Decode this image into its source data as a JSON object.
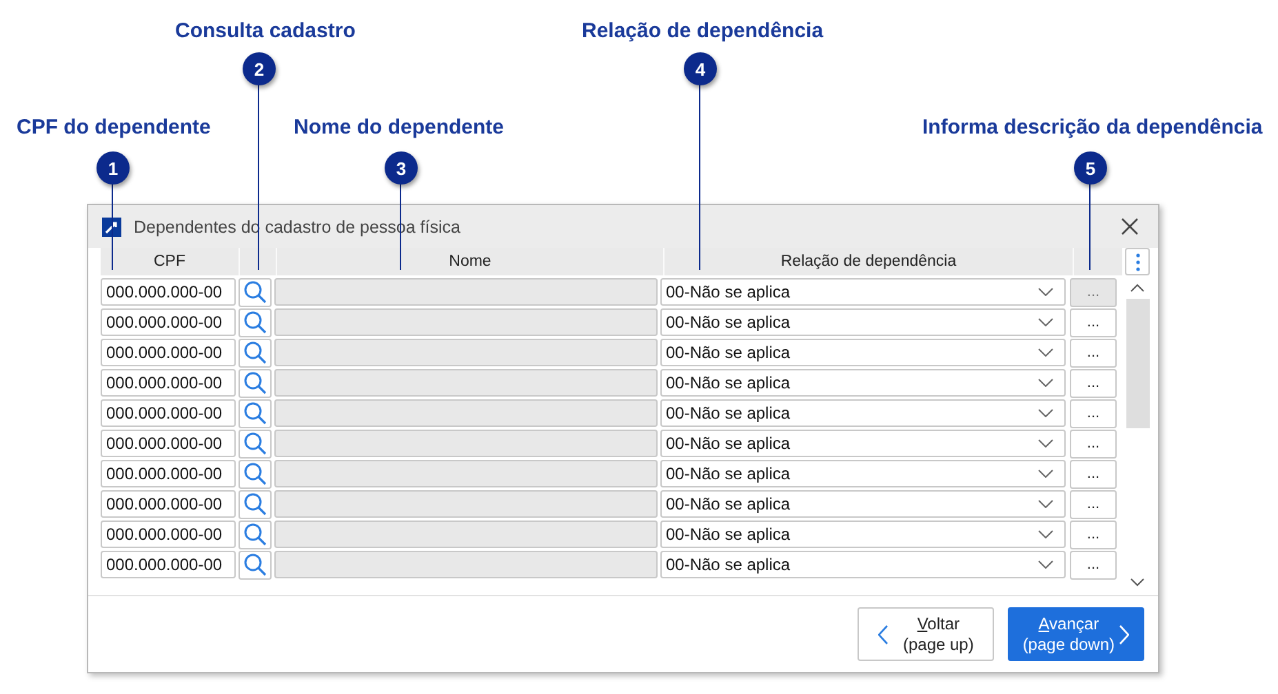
{
  "callouts": [
    {
      "number": "1",
      "label": "CPF do dependente"
    },
    {
      "number": "2",
      "label": "Consulta cadastro"
    },
    {
      "number": "3",
      "label": "Nome do dependente"
    },
    {
      "number": "4",
      "label": "Relação de dependência"
    },
    {
      "number": "5",
      "label": "Informa descrição da dependência"
    }
  ],
  "window": {
    "title": "Dependentes do cadastro de pessoa física"
  },
  "columns": [
    "CPF",
    "Nome",
    "Relação de dependência"
  ],
  "rows": [
    {
      "cpf": "000.000.000-00",
      "relation": "00-Não se aplica",
      "more": "...",
      "pressed": true
    },
    {
      "cpf": "000.000.000-00",
      "relation": "00-Não se aplica",
      "more": "...",
      "pressed": false
    },
    {
      "cpf": "000.000.000-00",
      "relation": "00-Não se aplica",
      "more": "...",
      "pressed": false
    },
    {
      "cpf": "000.000.000-00",
      "relation": "00-Não se aplica",
      "more": "...",
      "pressed": false
    },
    {
      "cpf": "000.000.000-00",
      "relation": "00-Não se aplica",
      "more": "...",
      "pressed": false
    },
    {
      "cpf": "000.000.000-00",
      "relation": "00-Não se aplica",
      "more": "...",
      "pressed": false
    },
    {
      "cpf": "000.000.000-00",
      "relation": "00-Não se aplica",
      "more": "...",
      "pressed": false
    },
    {
      "cpf": "000.000.000-00",
      "relation": "00-Não se aplica",
      "more": "...",
      "pressed": false
    },
    {
      "cpf": "000.000.000-00",
      "relation": "00-Não se aplica",
      "more": "...",
      "pressed": false
    },
    {
      "cpf": "000.000.000-00",
      "relation": "00-Não se aplica",
      "more": "...",
      "pressed": false
    }
  ],
  "buttons": [
    {
      "kind": "back",
      "accel": "V",
      "rest": "oltar",
      "sub": "(page up)"
    },
    {
      "kind": "next",
      "accel": "A",
      "rest": "vançar",
      "sub": "(page down)"
    }
  ]
}
